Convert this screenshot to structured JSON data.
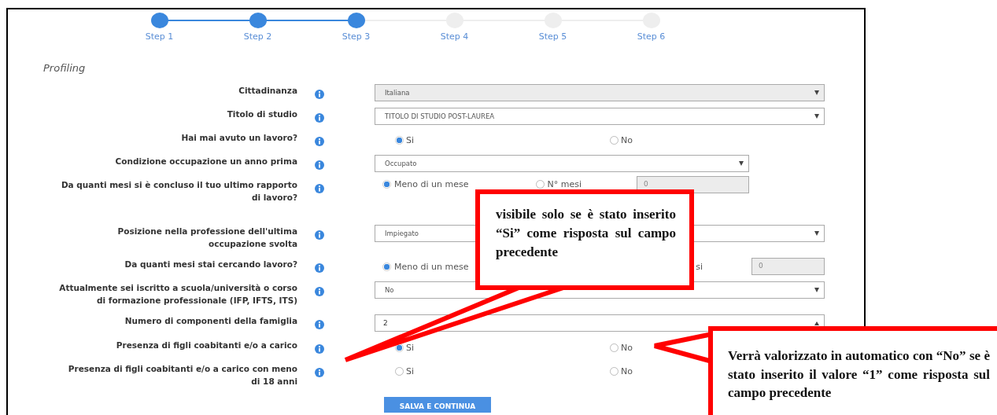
{
  "steps": [
    {
      "label": "Step 1",
      "done": true
    },
    {
      "label": "Step 2",
      "done": true
    },
    {
      "label": "Step 3",
      "done": true
    },
    {
      "label": "Step 4",
      "done": false
    },
    {
      "label": "Step 5",
      "done": false
    },
    {
      "label": "Step 6",
      "done": false
    }
  ],
  "section_title": "Profiling",
  "fields": [
    {
      "kind": "select",
      "label": "Cittadinanza",
      "value": "Italiana",
      "disabled": true
    },
    {
      "kind": "select",
      "label": "Titolo di studio",
      "value": "TITOLO DI STUDIO POST-LAUREA",
      "disabled": false,
      "short": false
    },
    {
      "kind": "radio",
      "label": "Hai mai avuto un lavoro?",
      "options": [
        {
          "label": "Si",
          "selected": true
        },
        {
          "label": "No",
          "selected": false
        }
      ]
    },
    {
      "kind": "select",
      "label": "Condizione occupazione un anno prima",
      "value": "Occupato",
      "disabled": false,
      "short": true
    },
    {
      "kind": "choice",
      "label": "Da quanti mesi si è concluso il tuo ultimo rapporto di lavoro?",
      "options": [
        {
          "label": "Meno di un mese",
          "selected": true
        },
        {
          "label": "N° mesi",
          "selected": false
        }
      ],
      "number": "0",
      "short": true
    },
    {
      "kind": "select",
      "label": "Posizione nella professione dell'ultima occupazione svolta",
      "value": "Impiegato",
      "disabled": false,
      "short": false
    },
    {
      "kind": "choice",
      "label": "Da quanti mesi stai cercando lavoro?",
      "options": [
        {
          "label": "Meno di un mese",
          "selected": true
        },
        {
          "label": "si"
        }
      ],
      "number": "0",
      "short": false
    },
    {
      "kind": "select",
      "label": "Attualmente sei iscritto a scuola/università o corso di formazione professionale (IFP, IFTS, ITS)",
      "value": "No",
      "disabled": false,
      "short": false
    },
    {
      "kind": "number",
      "label": "Numero di componenti della famiglia",
      "value": "2"
    },
    {
      "kind": "radio",
      "label": "Presenza di figli coabitanti e/o a carico",
      "options": [
        {
          "label": "Si",
          "selected": true
        },
        {
          "label": "No",
          "selected": false
        }
      ]
    },
    {
      "kind": "radio",
      "label": "Presenza di figli coabitanti e/o a carico con meno di 18 anni",
      "options": [
        {
          "label": "Si",
          "selected": false
        },
        {
          "label": "No",
          "selected": false
        }
      ]
    }
  ],
  "submit": "SALVA E CONTINUA",
  "callouts": [
    {
      "text": "visibile solo se è stato inserito “Si” come risposta sul campo precedente"
    },
    {
      "text": "Verrà valorizzato in automatico con “No” se è stato inserito il valore “1” come risposta sul campo precedente"
    }
  ]
}
